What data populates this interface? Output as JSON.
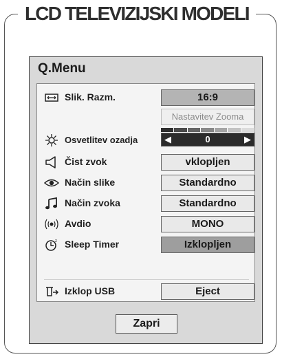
{
  "section_title": "LCD TELEVIZIJSKI MODELI",
  "menu": {
    "title": "Q.Menu",
    "items": [
      {
        "label": "Slik. Razm.",
        "value": "16:9",
        "icon": "aspect-ratio-icon"
      },
      {
        "value": "Nastavitev Zooma"
      },
      {
        "label": "Osvetlitev ozadja",
        "value": "0",
        "icon": "brightness-icon"
      },
      {
        "label": "Čist zvok",
        "value": "vklopljen",
        "icon": "speaker-icon"
      },
      {
        "label": "Način slike",
        "value": "Standardno",
        "icon": "eye-icon"
      },
      {
        "label": "Način zvoka",
        "value": "Standardno",
        "icon": "music-note-icon"
      },
      {
        "label": "Avdio",
        "value": "MONO",
        "icon": "audio-waves-icon"
      },
      {
        "label": "Sleep Timer",
        "value": "Izklopljen",
        "icon": "sleep-timer-icon"
      },
      {
        "label": "Izklop USB",
        "value": "Eject",
        "icon": "usb-eject-icon"
      }
    ],
    "close_label": "Zapri"
  }
}
